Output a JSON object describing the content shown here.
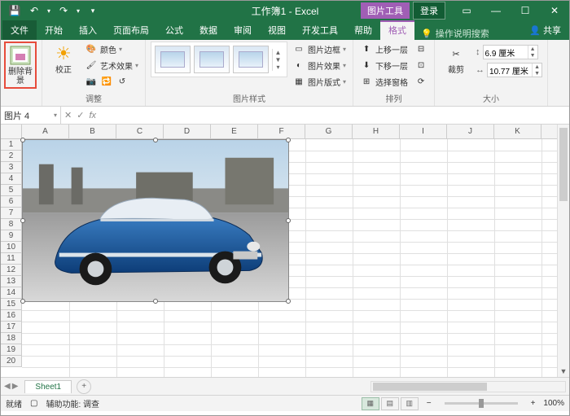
{
  "title": "工作簿1 - Excel",
  "contextual_tab_group": "图片工具",
  "login": "登录",
  "tabs": {
    "file": "文件",
    "home": "开始",
    "insert": "插入",
    "layout": "页面布局",
    "formula": "公式",
    "data": "数据",
    "review": "审阅",
    "view": "视图",
    "dev": "开发工具",
    "help": "帮助",
    "format": "格式"
  },
  "tellme": "操作说明搜索",
  "share": "共享",
  "ribbon": {
    "remove_bg": "删除背景",
    "corrections": "校正",
    "color": "颜色",
    "artistic": "艺术效果",
    "adjust_group": "调整",
    "styles_group": "图片样式",
    "border": "图片边框",
    "effects": "图片效果",
    "layout_pic": "图片版式",
    "bring_fwd": "上移一层",
    "send_back": "下移一层",
    "selection": "选择窗格",
    "arrange_group": "排列",
    "crop": "裁剪",
    "height_val": "6.9 厘米",
    "width_val": "10.77 厘米",
    "size_group": "大小"
  },
  "namebox": "图片 4",
  "columns": [
    "A",
    "B",
    "C",
    "D",
    "E",
    "F",
    "G",
    "H",
    "I",
    "J",
    "K"
  ],
  "rows": [
    "1",
    "2",
    "3",
    "4",
    "5",
    "6",
    "7",
    "8",
    "9",
    "10",
    "11",
    "12",
    "13",
    "14",
    "15",
    "16",
    "17",
    "18",
    "19",
    "20"
  ],
  "sheet": "Sheet1",
  "status": {
    "ready": "就绪",
    "acc": "辅助功能: 调查",
    "zoom": "100%"
  }
}
